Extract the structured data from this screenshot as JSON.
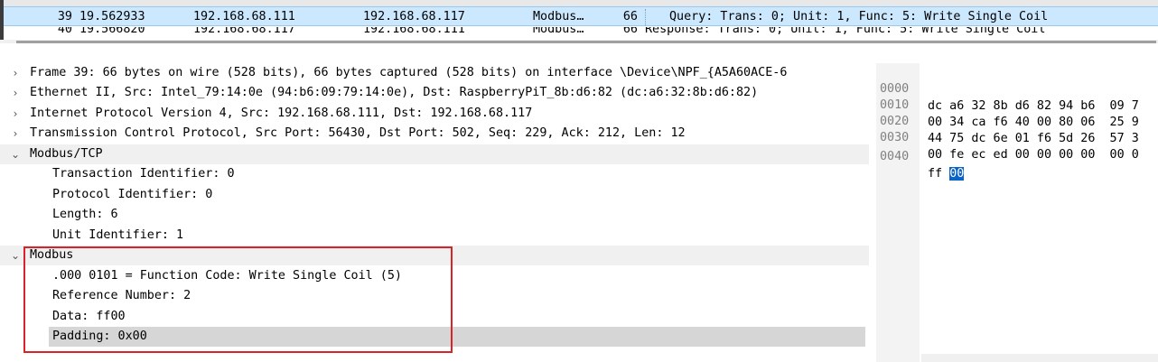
{
  "packet_list": {
    "selected": {
      "no": "39",
      "time": "19.562933",
      "source": "192.168.68.111",
      "destination": "192.168.68.117",
      "protocol": "Modbus…",
      "length": "66",
      "info": "Query: Trans:    0; Unit:   1, Func:   5: Write Single Coil"
    },
    "next": {
      "no": "40",
      "time": "19.566820",
      "source": "192.168.68.117",
      "destination": "192.168.68.111",
      "protocol": "Modbus…",
      "length": "66",
      "info": "Response: Trans:    0; Unit:   1, Func:   5: Write Single Coil"
    },
    "colors": {
      "selected_bg": "#cce8ff"
    }
  },
  "details": {
    "rows": [
      {
        "label": "Frame 39: 66 bytes on wire (528 bits), 66 bytes captured (528 bits) on interface \\Device\\NPF_{A5A60ACE-6",
        "expand": "collapsed"
      },
      {
        "label": "Ethernet II, Src: Intel_79:14:0e (94:b6:09:79:14:0e), Dst: RaspberryPiT_8b:d6:82 (dc:a6:32:8b:d6:82)",
        "expand": "collapsed"
      },
      {
        "label": "Internet Protocol Version 4, Src: 192.168.68.111, Dst: 192.168.68.117",
        "expand": "collapsed"
      },
      {
        "label": "Transmission Control Protocol, Src Port: 56430, Dst Port: 502, Seq: 229, Ack: 212, Len: 12",
        "expand": "collapsed"
      },
      {
        "label": "Modbus/TCP",
        "expand": "expanded"
      },
      {
        "label": "Transaction Identifier: 0"
      },
      {
        "label": "Protocol Identifier: 0"
      },
      {
        "label": "Length: 6"
      },
      {
        "label": "Unit Identifier: 1"
      },
      {
        "label": "Modbus",
        "expand": "expanded"
      },
      {
        "label": ".000 0101 = Function Code: Write Single Coil (5)"
      },
      {
        "label": "Reference Number: 2"
      },
      {
        "label": "Data: ff00"
      },
      {
        "label": "Padding: 0x00",
        "selected": true
      }
    ],
    "icons": {
      "collapsed": "chevron-right-icon",
      "expanded": "chevron-down-icon"
    },
    "colors": {
      "annotation_box": "#d9232b",
      "selected_row": "#d6d6d6"
    }
  },
  "bytes": {
    "lines": [
      {
        "offset": "0000",
        "hex": "dc a6 32 8b d6 82 94 b6  09 7"
      },
      {
        "offset": "0010",
        "hex": "00 34 ca f6 40 00 80 06  25 9"
      },
      {
        "offset": "0020",
        "hex": "44 75 dc 6e 01 f6 5d 26  57 3"
      },
      {
        "offset": "0030",
        "hex": "00 fe ec ed 00 00 00 00  00 0"
      },
      {
        "offset": "0040",
        "hex_plain": "ff ",
        "hex_selected": "00"
      }
    ],
    "colors": {
      "selected_byte": "#0a64c8"
    }
  }
}
